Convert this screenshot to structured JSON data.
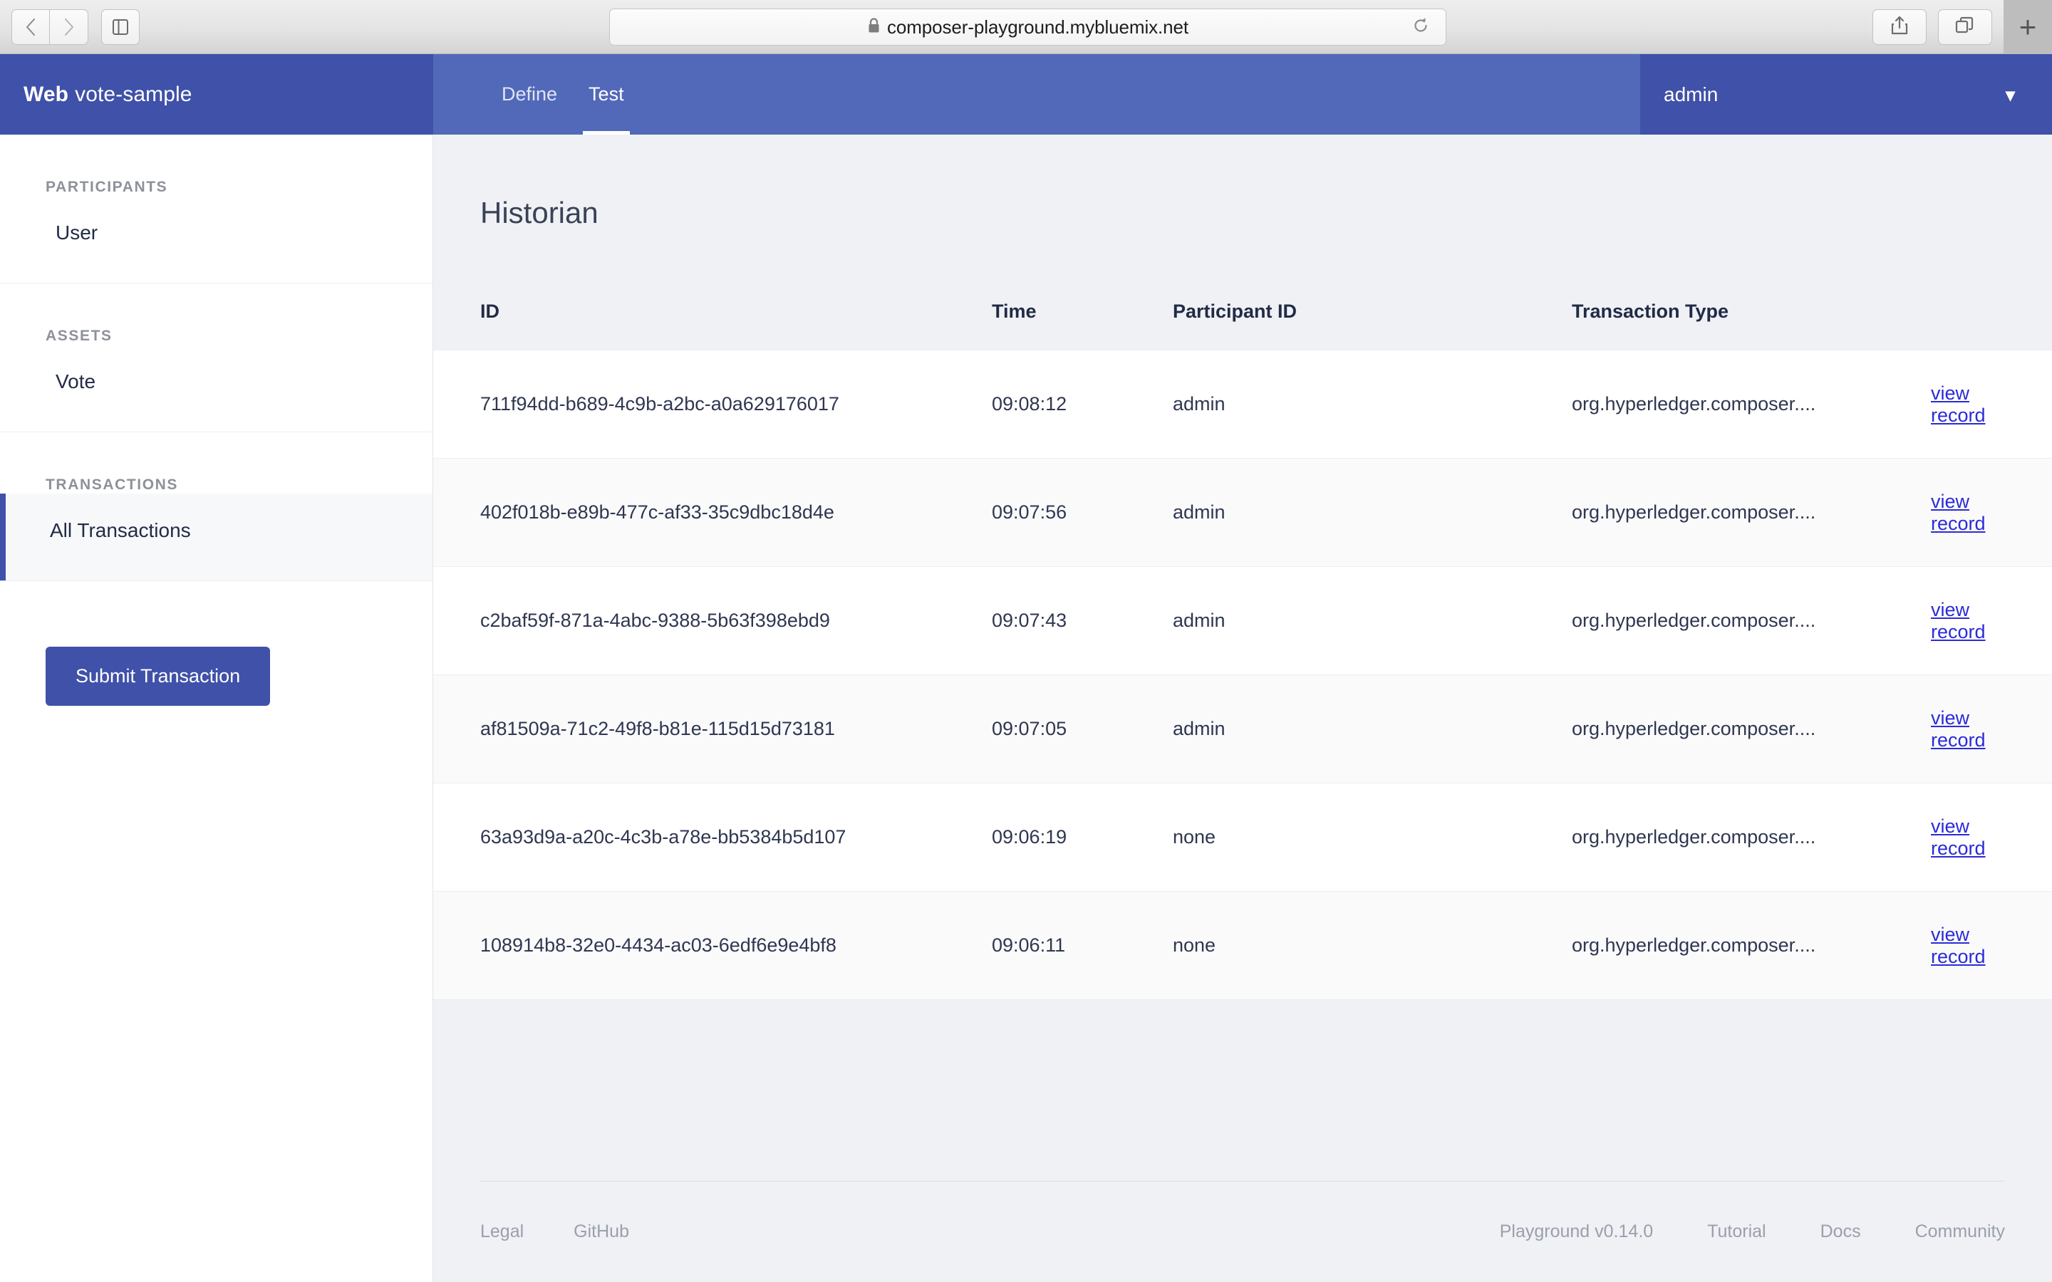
{
  "browser": {
    "url": "composer-playground.mybluemix.net",
    "lock_icon": "lock-icon",
    "back_icon": "back-chevron-icon",
    "forward_icon": "forward-chevron-icon",
    "sidebar_toggle_icon": "sidebar-toggle-icon",
    "reload_icon": "reload-icon",
    "share_icon": "share-icon",
    "tabs_icon": "show-tabs-icon",
    "newtab_label": "+"
  },
  "header": {
    "brand_bold": "Web",
    "brand_light": "vote-sample",
    "tabs": [
      {
        "label": "Define",
        "active": false
      },
      {
        "label": "Test",
        "active": true
      }
    ],
    "user": "admin",
    "chevron_icon": "chevron-down-icon"
  },
  "sidebar": {
    "groups": [
      {
        "heading": "PARTICIPANTS",
        "items": [
          {
            "label": "User",
            "selected": false
          }
        ]
      },
      {
        "heading": "ASSETS",
        "items": [
          {
            "label": "Vote",
            "selected": false
          }
        ]
      },
      {
        "heading": "TRANSACTIONS",
        "items": [
          {
            "label": "All Transactions",
            "selected": true
          }
        ]
      }
    ],
    "submit_label": "Submit Transaction"
  },
  "main": {
    "title": "Historian",
    "columns": {
      "id": "ID",
      "time": "Time",
      "participant": "Participant ID",
      "type": "Transaction Type",
      "action": ""
    },
    "rows": [
      {
        "id": "711f94dd-b689-4c9b-a2bc-a0a629176017",
        "time": "09:08:12",
        "participant": "admin",
        "type": "org.hyperledger.composer....",
        "link": "view record"
      },
      {
        "id": "402f018b-e89b-477c-af33-35c9dbc18d4e",
        "time": "09:07:56",
        "participant": "admin",
        "type": "org.hyperledger.composer....",
        "link": "view record"
      },
      {
        "id": "c2baf59f-871a-4abc-9388-5b63f398ebd9",
        "time": "09:07:43",
        "participant": "admin",
        "type": "org.hyperledger.composer....",
        "link": "view record"
      },
      {
        "id": "af81509a-71c2-49f8-b81e-115d15d73181",
        "time": "09:07:05",
        "participant": "admin",
        "type": "org.hyperledger.composer....",
        "link": "view record"
      },
      {
        "id": "63a93d9a-a20c-4c3b-a78e-bb5384b5d107",
        "time": "09:06:19",
        "participant": "none",
        "type": "org.hyperledger.composer....",
        "link": "view record"
      },
      {
        "id": "108914b8-32e0-4434-ac03-6edf6e9e4bf8",
        "time": "09:06:11",
        "participant": "none",
        "type": "org.hyperledger.composer....",
        "link": "view record"
      }
    ]
  },
  "footer": {
    "left": [
      "Legal",
      "GitHub"
    ],
    "version": "Playground v0.14.0",
    "right": [
      "Tutorial",
      "Docs",
      "Community"
    ]
  },
  "colors": {
    "brand_dark": "#3f51a8",
    "brand": "#5269ba",
    "page_bg": "#eff1f5",
    "link": "#2b2bd8"
  }
}
